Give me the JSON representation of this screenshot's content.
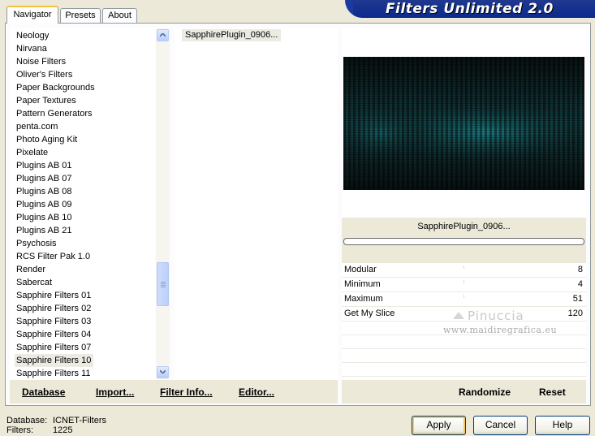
{
  "tabs": [
    {
      "label": "Navigator",
      "active": true
    },
    {
      "label": "Presets",
      "active": false
    },
    {
      "label": "About",
      "active": false
    }
  ],
  "banner": {
    "title": "Filters Unlimited 2.0"
  },
  "category_list": {
    "items": [
      "Neology",
      "Nirvana",
      "Noise Filters",
      "Oliver's Filters",
      "Paper Backgrounds",
      "Paper Textures",
      "Pattern Generators",
      "penta.com",
      "Photo Aging Kit",
      "Pixelate",
      "Plugins AB 01",
      "Plugins AB 07",
      "Plugins AB 08",
      "Plugins AB 09",
      "Plugins AB 10",
      "Plugins AB 21",
      "Psychosis",
      "RCS Filter Pak 1.0",
      "Render",
      "Sabercat",
      "Sapphire Filters 01",
      "Sapphire Filters 02",
      "Sapphire Filters 03",
      "Sapphire Filters 04",
      "Sapphire Filters 07",
      "Sapphire Filters 10",
      "Sapphire Filters 11"
    ],
    "selected": "Sapphire Filters 10"
  },
  "filter_list": {
    "items": [
      "SapphirePlugin_0906..."
    ],
    "selected": "SapphirePlugin_0906..."
  },
  "preview": {
    "filter_name": "SapphirePlugin_0906...",
    "progress_percent": 0
  },
  "parameters": [
    {
      "name": "Modular",
      "value": "8"
    },
    {
      "name": "Minimum",
      "value": "4"
    },
    {
      "name": "Maximum",
      "value": "51"
    },
    {
      "name": "Get My Slice",
      "value": "120"
    }
  ],
  "watermark": {
    "name": "Pinuccia",
    "url": "www.maidiregrafica.eu"
  },
  "toolbar": {
    "database": "Database",
    "import": "Import...",
    "filter_info": "Filter Info...",
    "editor": "Editor...",
    "randomize": "Randomize",
    "reset": "Reset"
  },
  "status": {
    "database_label": "Database:",
    "database_value": "ICNET-Filters",
    "filters_label": "Filters:",
    "filters_value": "1225"
  },
  "buttons": {
    "apply": "Apply",
    "cancel": "Cancel",
    "help": "Help"
  },
  "colors": {
    "banner": "#0b2a8e",
    "preview_accent": "#1c7d84",
    "selection": "#ebebe3"
  }
}
